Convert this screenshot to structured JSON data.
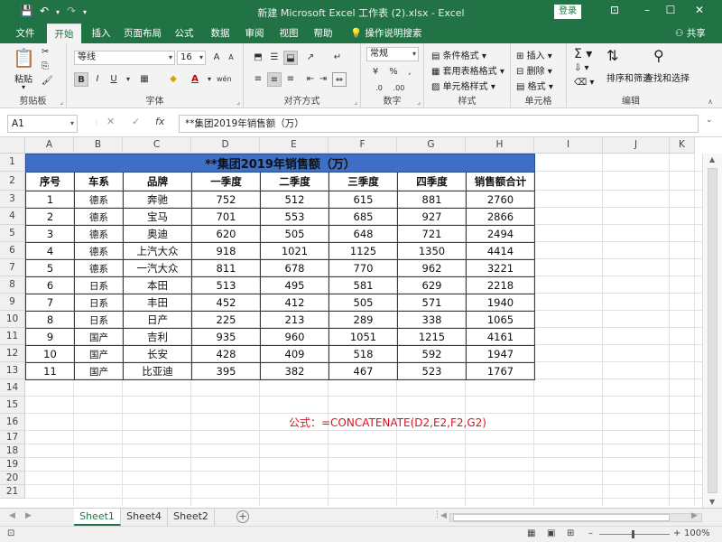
{
  "window": {
    "title": "新建 Microsoft Excel 工作表 (2).xlsx  -  Excel",
    "login": "登录",
    "minimize": "–",
    "restore": "☐",
    "close": "✕",
    "options": "⊡"
  },
  "quick_access": {
    "save": "💾",
    "undo": "↶",
    "redo": "↷",
    "more": "▾"
  },
  "tabs": [
    "文件",
    "开始",
    "插入",
    "页面布局",
    "公式",
    "数据",
    "审阅",
    "视图",
    "帮助"
  ],
  "active_tab": "开始",
  "tell_me": "操作说明搜索",
  "share": "共享",
  "ribbon": {
    "clipboard": {
      "label": "剪贴板",
      "paste": "粘贴"
    },
    "font": {
      "label": "字体",
      "font_name": "等线",
      "font_size": "16",
      "bold": "B",
      "italic": "I",
      "underline": "U",
      "grow": "A",
      "shrink": "A",
      "wen": "wén"
    },
    "alignment": {
      "label": "对齐方式"
    },
    "number": {
      "label": "数字",
      "format": "常规",
      "percent": "%",
      "comma": ",",
      "currency": "¥"
    },
    "styles": {
      "label": "样式",
      "conditional": "条件格式",
      "table": "套用表格格式",
      "cell": "单元格样式"
    },
    "cells": {
      "label": "单元格",
      "insert": "插入",
      "delete": "删除",
      "format": "格式"
    },
    "editing": {
      "label": "编辑",
      "sort": "排序和筛选",
      "find": "查找和选择"
    }
  },
  "formula_bar": {
    "name_box": "A1",
    "fx": "fx",
    "cancel": "✕",
    "enter": "✓",
    "content": "**集团2019年销售额（万）"
  },
  "columns": [
    "A",
    "B",
    "C",
    "D",
    "E",
    "F",
    "G",
    "H",
    "I",
    "J",
    "K"
  ],
  "rows": [
    "1",
    "2",
    "3",
    "4",
    "5",
    "6",
    "7",
    "8",
    "9",
    "10",
    "11",
    "12",
    "13",
    "14",
    "15",
    "16",
    "17",
    "18",
    "19",
    "20",
    "21"
  ],
  "table": {
    "title": "**集团2019年销售额（万）",
    "headers": [
      "序号",
      "车系",
      "品牌",
      "一季度",
      "二季度",
      "三季度",
      "四季度",
      "销售额合计"
    ],
    "rows": [
      [
        "1",
        "德系",
        "奔驰",
        "752",
        "512",
        "615",
        "881",
        "2760"
      ],
      [
        "2",
        "德系",
        "宝马",
        "701",
        "553",
        "685",
        "927",
        "2866"
      ],
      [
        "3",
        "德系",
        "奥迪",
        "620",
        "505",
        "648",
        "721",
        "2494"
      ],
      [
        "4",
        "德系",
        "上汽大众",
        "918",
        "1021",
        "1125",
        "1350",
        "4414"
      ],
      [
        "5",
        "德系",
        "一汽大众",
        "811",
        "678",
        "770",
        "962",
        "3221"
      ],
      [
        "6",
        "日系",
        "本田",
        "513",
        "495",
        "581",
        "629",
        "2218"
      ],
      [
        "7",
        "日系",
        "丰田",
        "452",
        "412",
        "505",
        "571",
        "1940"
      ],
      [
        "8",
        "日系",
        "日产",
        "225",
        "213",
        "289",
        "338",
        "1065"
      ],
      [
        "9",
        "国产",
        "吉利",
        "935",
        "960",
        "1051",
        "1215",
        "4161"
      ],
      [
        "10",
        "国产",
        "长安",
        "428",
        "409",
        "518",
        "592",
        "1947"
      ],
      [
        "11",
        "国产",
        "比亚迪",
        "395",
        "382",
        "467",
        "523",
        "1767"
      ]
    ]
  },
  "note": "公式：=CONCATENATE(D2,E2,F2,G2)",
  "sheets": [
    "Sheet1",
    "Sheet4",
    "Sheet2"
  ],
  "active_sheet": "Sheet1",
  "status": {
    "zoom": "100%",
    "minus": "–",
    "plus": "+"
  },
  "colors": {
    "excel_green": "#217346",
    "title_fill": "#3f6fc4",
    "note_red": "#e0101a"
  }
}
